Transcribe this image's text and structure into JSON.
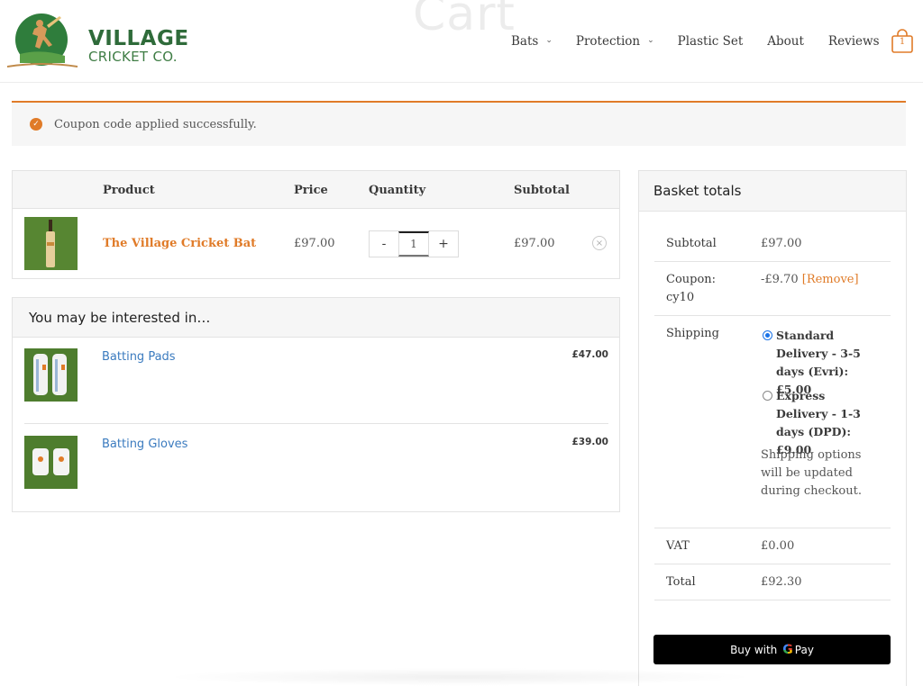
{
  "page": {
    "ghost_title": "Cart"
  },
  "brand": {
    "line1": "VILLAGE",
    "line2": "CRICKET CO.",
    "colors": {
      "green": "#2f6b3a",
      "accent": "#e07b28"
    }
  },
  "nav": {
    "items": [
      {
        "label": "Bats",
        "has_dropdown": true
      },
      {
        "label": "Protection",
        "has_dropdown": true
      },
      {
        "label": "Plastic Set",
        "has_dropdown": false
      },
      {
        "label": "About",
        "has_dropdown": false
      },
      {
        "label": "Reviews",
        "has_dropdown": false
      }
    ],
    "cart_count": "1"
  },
  "notice": {
    "text": "Coupon code applied successfully."
  },
  "cart": {
    "headers": {
      "product": "Product",
      "price": "Price",
      "quantity": "Quantity",
      "subtotal": "Subtotal"
    },
    "items": [
      {
        "name": "The Village Cricket Bat",
        "price": "£97.00",
        "quantity": "1",
        "subtotal": "£97.00",
        "minus": "-",
        "plus": "+",
        "remove": "×"
      }
    ]
  },
  "interested": {
    "title": "You may be interested in…",
    "items": [
      {
        "name": "Batting Pads",
        "price": "£47.00"
      },
      {
        "name": "Batting Gloves",
        "price": "£39.00"
      }
    ]
  },
  "totals": {
    "title": "Basket totals",
    "subtotal_label": "Subtotal",
    "subtotal_value": "£97.00",
    "coupon_label": "Coupon: cy10",
    "coupon_value": "-£9.70",
    "coupon_remove": "[Remove]",
    "shipping_label": "Shipping",
    "shipping_options": [
      {
        "label": "Standard Delivery - 3-5 days (Evri): £5.00",
        "checked": true
      },
      {
        "label": "Express Delivery - 1-3 days (DPD): £9.00",
        "checked": false
      }
    ],
    "shipping_note": "Shipping options will be updated during checkout.",
    "vat_label": "VAT",
    "vat_value": "£0.00",
    "total_label": "Total",
    "total_value": "£92.30"
  },
  "gpay": {
    "prefix": "Buy with",
    "g": "G",
    "suffix": "Pay"
  }
}
